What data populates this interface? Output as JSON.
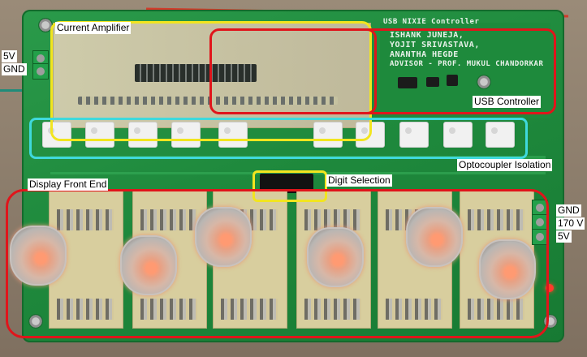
{
  "image": {
    "description_labels": {
      "current_amplifier": "Current Amplifier",
      "usb_controller": "USB Controller",
      "optocoupler_isolation": "Optocoupler Isolation",
      "display_front_end": "Display Front End",
      "digit_selection": "Digit Selection"
    },
    "left_power": {
      "v": "5V",
      "gnd": "GND"
    },
    "right_power": {
      "gnd": "GND",
      "hv": "170 V",
      "v": "5V"
    },
    "silkscreen": {
      "title": "USB NIXIE Controller",
      "line1": "ISHANK JUNEJA,",
      "line2": "YOJIT SRIVASTAVA,",
      "line3": "ANANTHA HEGDE",
      "line4": "ADVISOR - PROF. MUKUL CHANDORKAR"
    },
    "highlight_colors": {
      "yellow": "#f2e51f",
      "red": "#e0151b",
      "cyan": "#3fd9dc"
    }
  }
}
